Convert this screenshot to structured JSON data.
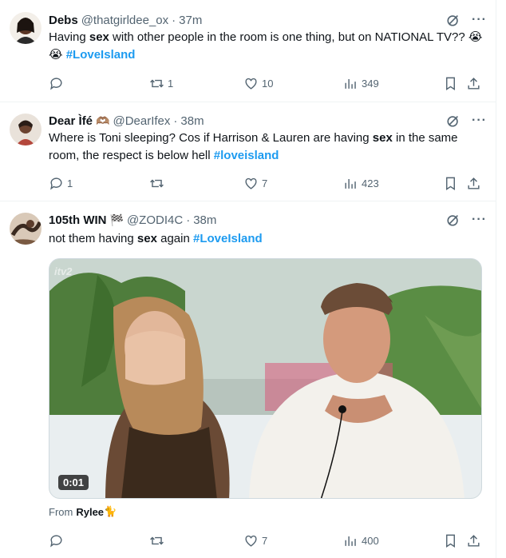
{
  "tweets": [
    {
      "name": "Debs",
      "handle": "@thatgirldee_ox",
      "time": "37m",
      "text_parts": [
        "Having ",
        "sex",
        " with other people in the room is one thing, but on NATIONAL TV?? ",
        "😭😭",
        " ",
        "#LoveIsland"
      ],
      "replies": "",
      "retweets": "1",
      "likes": "10",
      "views": "349"
    },
    {
      "name": "Dear Ìfé",
      "name_emoji": "🫶🏽",
      "handle": "@DearIfex",
      "time": "38m",
      "text_parts": [
        "Where is Toni sleeping? Cos if Harrison & Lauren are having ",
        "sex",
        " in the same room, the respect is below hell ",
        "#loveisland"
      ],
      "replies": "1",
      "retweets": "",
      "likes": "7",
      "views": "423"
    },
    {
      "name": "105th WIN",
      "name_emoji": "🏁",
      "handle": "@ZODI4C",
      "time": "38m",
      "text_parts": [
        "not them having ",
        "sex",
        " again ",
        "#LoveIsland"
      ],
      "media": {
        "duration": "0:01",
        "watermark": "itv2"
      },
      "from_label": "From",
      "from_user": "Rylee",
      "from_emoji": "🐈",
      "replies": "",
      "retweets": "",
      "likes": "7",
      "views": "400"
    }
  ],
  "colors": {
    "link": "#1d9bf0",
    "muted": "#536471",
    "text": "#0f1419"
  },
  "icons": [
    "grok-icon",
    "more-icon",
    "reply-icon",
    "retweet-icon",
    "like-icon",
    "views-icon",
    "bookmark-icon",
    "share-icon"
  ]
}
